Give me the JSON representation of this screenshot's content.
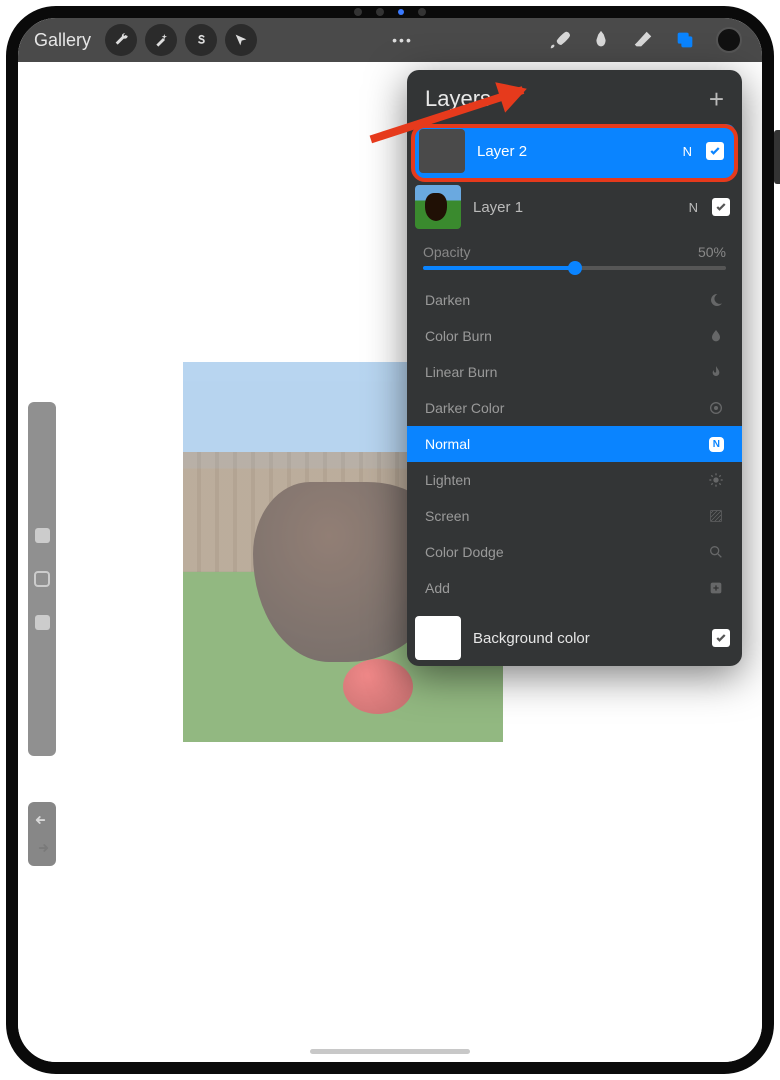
{
  "topbar": {
    "gallery_label": "Gallery",
    "more_dots": "•••"
  },
  "panel": {
    "title": "Layers",
    "opacity_label": "Opacity",
    "opacity_value": "50%",
    "background_label": "Background color"
  },
  "layers": [
    {
      "name": "Layer 2",
      "blend_letter": "N"
    },
    {
      "name": "Layer 1",
      "blend_letter": "N"
    }
  ],
  "blend_modes": {
    "darken": "Darken",
    "color_burn": "Color Burn",
    "linear_burn": "Linear Burn",
    "darker_color": "Darker Color",
    "normal": "Normal",
    "normal_badge": "N",
    "lighten": "Lighten",
    "screen": "Screen",
    "color_dodge": "Color Dodge",
    "add": "Add"
  }
}
